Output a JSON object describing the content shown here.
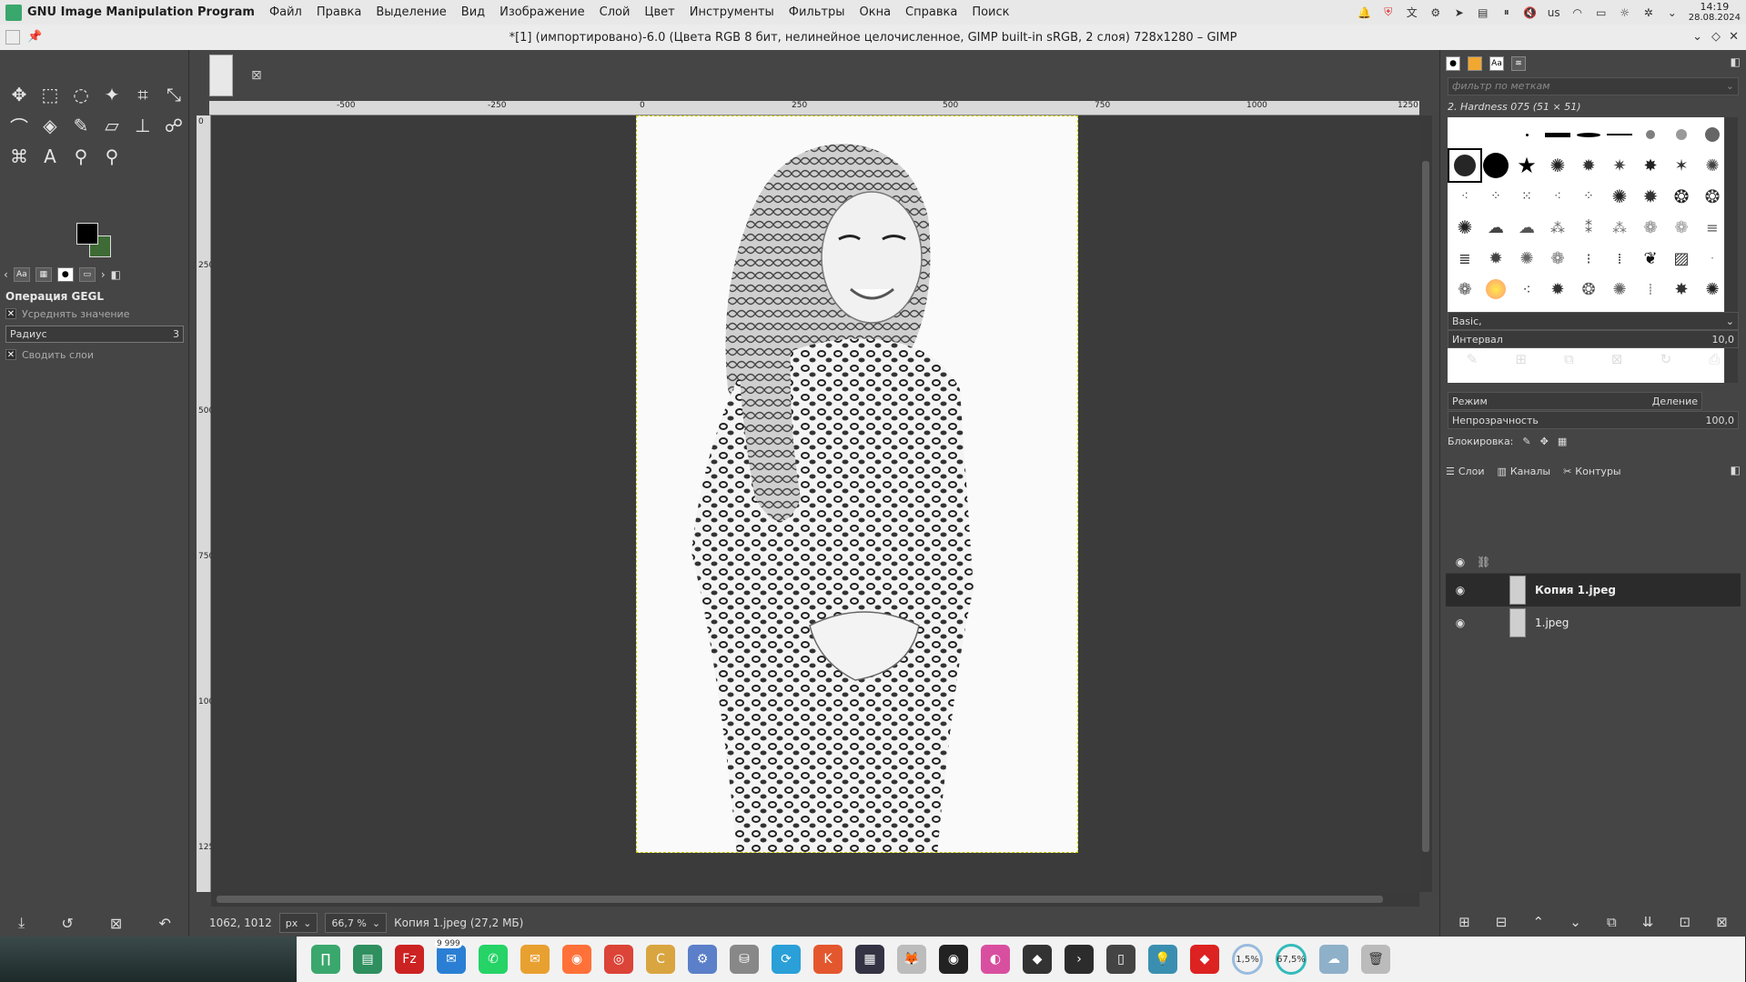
{
  "top_panel": {
    "app_title": "GNU Image Manipulation Program",
    "menus": [
      "Файл",
      "Правка",
      "Выделение",
      "Вид",
      "Изображение",
      "Слой",
      "Цвет",
      "Инструменты",
      "Фильтры",
      "Окна",
      "Справка",
      "Поиск"
    ],
    "tray": {
      "keyboard_layout": "us",
      "time": "14:19",
      "date": "28.08.2024"
    }
  },
  "window": {
    "title": "*[1] (импортировано)-6.0 (Цвета RGB 8 бит, нелинейное целочисленное, GIMP built-in sRGB, 2 слоя) 728x1280 – GIMP"
  },
  "toolbox": {
    "tools": [
      {
        "name": "move-tool-icon",
        "glyph": "✥"
      },
      {
        "name": "rect-select-icon",
        "glyph": "⬚"
      },
      {
        "name": "lasso-icon",
        "glyph": "◌"
      },
      {
        "name": "fuzzy-select-icon",
        "glyph": "✦"
      },
      {
        "name": "crop-icon",
        "glyph": "⌗"
      },
      {
        "name": "transform-icon",
        "glyph": "⤡"
      },
      {
        "name": "warp-icon",
        "glyph": "⌒"
      },
      {
        "name": "bucket-fill-icon",
        "glyph": "◈"
      },
      {
        "name": "paintbrush-icon",
        "glyph": "✎"
      },
      {
        "name": "eraser-icon",
        "glyph": "▱"
      },
      {
        "name": "clone-icon",
        "glyph": "⊥"
      },
      {
        "name": "smudge-icon",
        "glyph": "☍"
      },
      {
        "name": "paths-icon",
        "glyph": "⌘"
      },
      {
        "name": "text-tool-icon",
        "glyph": "A"
      },
      {
        "name": "color-picker-icon",
        "glyph": "⚲"
      },
      {
        "name": "zoom-icon",
        "glyph": "⚲"
      }
    ],
    "fg_color": "#000000",
    "bg_color": "#3e6b35",
    "tool_options": {
      "title": "Операция GEGL",
      "checkbox1_label": "Усреднять значение",
      "radius_label": "Радиус",
      "radius_value": "3",
      "checkbox2_label": "Сводить слои"
    }
  },
  "rulers": {
    "h_labels": [
      "-500",
      "-250",
      "0",
      "250",
      "500",
      "750",
      "1000",
      "1250"
    ],
    "v_labels": [
      "0",
      "250",
      "500",
      "750",
      "1000",
      "1250"
    ]
  },
  "statusbar": {
    "coords": "1062, 1012",
    "unit": "px",
    "zoom": "66,7 %",
    "info": "Копия 1.jpeg (27,2 МБ)"
  },
  "brushes": {
    "filter_placeholder": "фильтр по меткам",
    "current_brush": "2. Hardness 075 (51 × 51)",
    "preset": "Basic,",
    "spacing_label": "Интервал",
    "spacing_value": "10,0"
  },
  "layers": {
    "tabs": [
      "Слои",
      "Каналы",
      "Контуры"
    ],
    "mode_label": "Режим",
    "mode_value": "Деление",
    "opacity_label": "Непрозрачность",
    "opacity_value": "100,0",
    "lock_label": "Блокировка:",
    "items": [
      {
        "name": "Копия 1.jpeg",
        "active": true
      },
      {
        "name": "1.jpeg",
        "active": false
      }
    ]
  },
  "taskbar": {
    "messenger_badge": "9 999",
    "cpu_load": "1,5%",
    "mem_load": "67,5%"
  }
}
